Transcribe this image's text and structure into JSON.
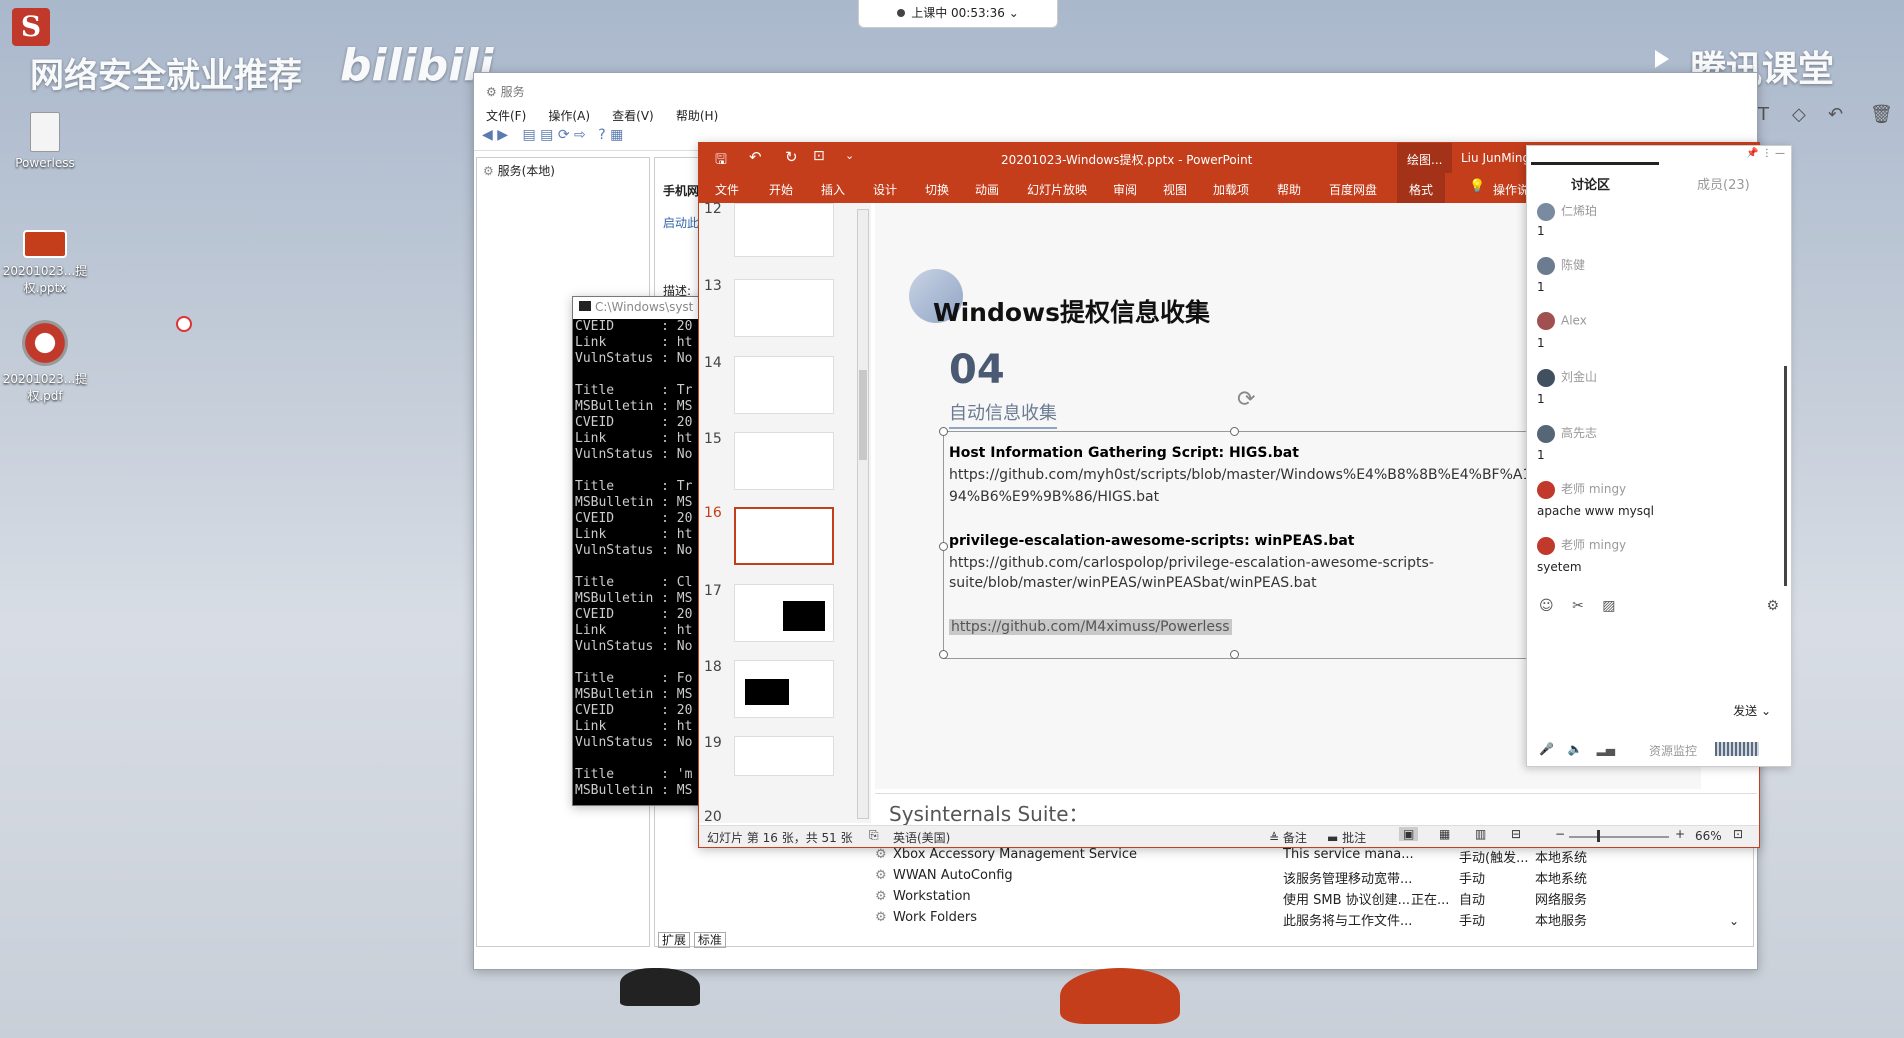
{
  "timer": {
    "label": "上课中 00:53:36"
  },
  "watermark": {
    "left": "网络安全就业推荐",
    "brand": "bilibili",
    "right": "腾讯课堂"
  },
  "desktop": {
    "icons": [
      {
        "label": "Powerless"
      },
      {
        "label": "20201023...提权.pptx"
      },
      {
        "label": "20201023...提权.pdf"
      }
    ]
  },
  "services_window": {
    "title": "服务",
    "menu": [
      "文件(F)",
      "操作(A)",
      "查看(V)",
      "帮助(H)"
    ],
    "tree_root": "服务(本地)",
    "partial_labels": [
      "手机网",
      "启动此",
      "描述:"
    ],
    "rows": [
      {
        "name": "Xbox Accessory Management Service",
        "desc": "This service mana...",
        "status": "",
        "startup": "手动(触发...",
        "logon": "本地系统"
      },
      {
        "name": "WWAN AutoConfig",
        "desc": "该服务管理移动宽带...",
        "status": "",
        "startup": "手动",
        "logon": "本地系统"
      },
      {
        "name": "Workstation",
        "desc": "使用 SMB 协议创建...",
        "status": "正在...",
        "startup": "自动",
        "logon": "网络服务"
      },
      {
        "name": "Work Folders",
        "desc": "此服务将与工作文件...",
        "status": "",
        "startup": "手动",
        "logon": "本地服务"
      }
    ],
    "tabs": [
      "扩展",
      "标准"
    ]
  },
  "cmd_window": {
    "title": "C:\\Windows\\syst",
    "lines": [
      "CVEID      : 20",
      "Link       : ht",
      "VulnStatus : No",
      "",
      "Title      : Tr",
      "MSBulletin : MS",
      "CVEID      : 20",
      "Link       : ht",
      "VulnStatus : No",
      "",
      "Title      : Tr",
      "MSBulletin : MS",
      "CVEID      : 20",
      "Link       : ht",
      "VulnStatus : No",
      "",
      "Title      : Cl",
      "MSBulletin : MS",
      "CVEID      : 20",
      "Link       : ht",
      "VulnStatus : No",
      "",
      "Title      : Fo",
      "MSBulletin : MS",
      "CVEID      : 20",
      "Link       : ht",
      "VulnStatus : No",
      "",
      "Title      : 'm",
      "MSBulletin : MS"
    ]
  },
  "ppt": {
    "title": "20201023-Windows提权.pptx  -  PowerPoint",
    "title_tab": "绘图...",
    "user": "Liu JunMing",
    "tabs": [
      "文件",
      "开始",
      "插入",
      "设计",
      "切换",
      "动画",
      "幻灯片放映",
      "审阅",
      "视图",
      "加载项",
      "帮助",
      "百度网盘",
      "格式",
      "操作说"
    ],
    "thumb_numbers": [
      "12",
      "13",
      "14",
      "15",
      "16",
      "17",
      "18",
      "19",
      "20"
    ],
    "slide": {
      "heading": "Windows提权信息收集",
      "number": "04",
      "subtitle": "自动信息收集",
      "line1_bold": "Host Information Gathering Script:  HIGS.bat",
      "line1_url_a": "https://github.com/myh0st/scripts/blob/master/Windows%E4%B8%8B%E4%BF%A1",
      "line1_url_b": "94%B6%E9%9B%86/HIGS.bat",
      "line2_bold": "privilege-escalation-awesome-scripts:  winPEAS.bat",
      "line2_url_a": "https://github.com/carlospolop/privilege-escalation-awesome-scripts-",
      "line2_url_b": "suite/blob/master/winPEAS/winPEASbat/winPEAS.bat",
      "line3_url": "https://github.com/M4ximuss/Powerless"
    },
    "notes": "Sysinternals Suite：",
    "status": {
      "slide_info": "幻灯片 第 16 张，共 51 张",
      "language": "英语(美国)",
      "notes_btn": "备注",
      "comments_btn": "批注",
      "zoom": "66%"
    }
  },
  "chat": {
    "tab_discussion": "讨论区",
    "tab_members": "成员(23)",
    "messages": [
      {
        "name": "仁烯珀",
        "text": "1",
        "color": "#7a8aa0"
      },
      {
        "name": "陈健",
        "text": "1",
        "color": "#6b7c8f"
      },
      {
        "name": "Alex",
        "text": "1",
        "color": "#a05050"
      },
      {
        "name": "刘金山",
        "text": "1",
        "color": "#405060"
      },
      {
        "name": "高先志",
        "text": "1",
        "color": "#556677"
      },
      {
        "name": "老师  mingy",
        "text": "apache www mysql",
        "color": "#c0392b"
      },
      {
        "name": "老师  mingy",
        "text": "syetem",
        "color": "#c0392b"
      }
    ],
    "send": "发送",
    "resource": "资源监控"
  }
}
